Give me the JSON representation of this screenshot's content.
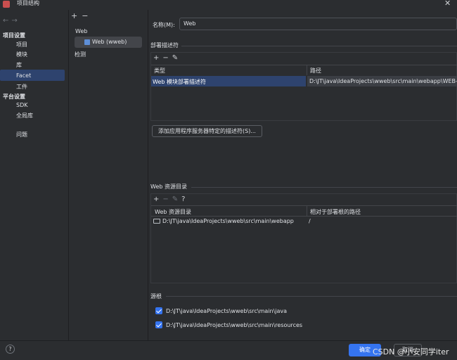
{
  "window": {
    "title": "项目结构"
  },
  "nav": {
    "back": "←",
    "forward": "→"
  },
  "sidebar": {
    "project_settings": "项目设置",
    "project_items": [
      "项目",
      "模块",
      "库",
      "Facet",
      "工件"
    ],
    "platform_settings": "平台设置",
    "platform_items": [
      "SDK",
      "全局库"
    ],
    "problems": "问题"
  },
  "middle": {
    "add": "+",
    "remove": "−",
    "group": "Web",
    "selected": "Web (wweb)",
    "detection": "检测"
  },
  "detail": {
    "name_label": "名称(M):",
    "name_value": "Web",
    "deploy": {
      "title": "部署描述符",
      "tools": [
        "+",
        "−",
        "✎"
      ],
      "columns": [
        "类型",
        "路径"
      ],
      "rows": [
        {
          "type": "Web 模块部署描述符",
          "path": "D:\\JT\\java\\IdeaProjects\\wweb\\src\\main\\webapp\\WEB-INF\\web.xml"
        }
      ],
      "add_server_button": "添加应用程序服务器特定的描述符(S)..."
    },
    "resources": {
      "title": "Web 资源目录",
      "tools": [
        "+",
        "−",
        "✎",
        "?"
      ],
      "columns": [
        "Web 资源目录",
        "相对于部署根的路径"
      ],
      "rows": [
        {
          "dir": "D:\\JT\\java\\IdeaProjects\\wweb\\src\\main\\webapp",
          "rel": "/"
        }
      ]
    },
    "sources": {
      "title": "源根",
      "roots": [
        {
          "path": "D:\\JT\\java\\IdeaProjects\\wweb\\src\\main\\java",
          "checked": true
        },
        {
          "path": "D:\\JT\\java\\IdeaProjects\\wweb\\src\\main\\resources",
          "checked": true
        }
      ]
    }
  },
  "footer": {
    "help": "?",
    "ok": "确定",
    "cancel": "取消",
    "watermark": "CSDN @小安同学iter"
  },
  "colors": {
    "accent": "#3574f0",
    "selection": "#2e436e",
    "background": "#2b2d30"
  }
}
